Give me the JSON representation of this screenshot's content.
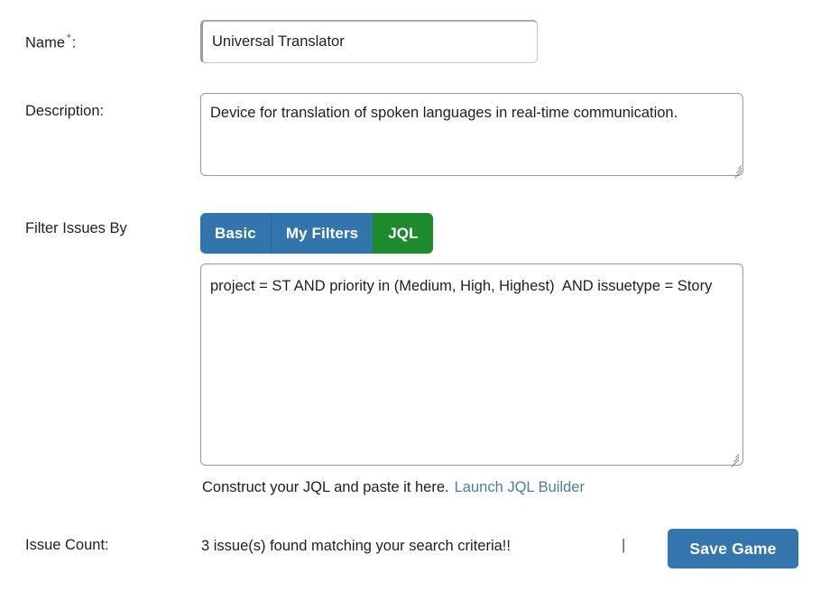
{
  "form": {
    "name_field": {
      "label": "Name",
      "required_marker": "*",
      "colon": ":",
      "value": "Universal Translator",
      "placeholder": "Name"
    },
    "description_field": {
      "label": "Description:",
      "value": "Device for translation of spoken languages in real-time communication.",
      "placeholder": "Description"
    },
    "filter_section": {
      "label": "Filter Issues By",
      "tabs": [
        {
          "label": "Basic",
          "active": false
        },
        {
          "label": "My Filters",
          "active": false
        },
        {
          "label": "JQL",
          "active": true
        }
      ],
      "jql_value": "project = ST AND priority in (Medium, High, Highest)  AND issuetype = Story",
      "jql_placeholder": "Enter JQL",
      "help_text": "Construct your JQL and paste it here.",
      "help_link": "Launch JQL Builder"
    },
    "issue_count_section": {
      "label": "Issue Count:",
      "result_text": "3 issue(s) found matching your search criteria!!",
      "separator": "|",
      "save_button": "Save Game"
    }
  },
  "colors": {
    "tab_blue": "#3275ad",
    "tab_green": "#1d8a2e",
    "button_blue": "#3575ad",
    "link_blue": "#4a7fa0",
    "required_red": "#b5302a"
  }
}
